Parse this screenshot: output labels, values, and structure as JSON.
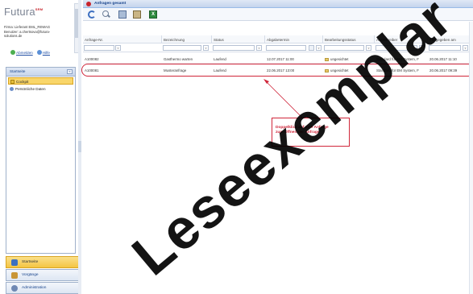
{
  "app": {
    "logo_text": "Futura",
    "logo_sup": "SRM",
    "user_lines": [
      "Firma: Lieferant EML_REWAG",
      "Benutzer: a.chertsova@futura-",
      "solutions.de"
    ],
    "logout_label": "Abmelden",
    "help_label": "Hilfe"
  },
  "sidebar": {
    "panel_title": "Startseite",
    "collapse_glyph": "«",
    "items": [
      {
        "label": "Cockpit",
        "selected": true
      },
      {
        "label": "Persönliche Daten",
        "selected": false
      }
    ]
  },
  "bottom_tabs": [
    {
      "label": "Startseite",
      "active": true
    },
    {
      "label": "Vorgänge",
      "active": false
    },
    {
      "label": "Administration",
      "active": false
    }
  ],
  "main": {
    "title": "Anfragen gesamt",
    "toolbar": {
      "excel_glyph": "X"
    },
    "columns": [
      {
        "label": "Anfrage-Nr."
      },
      {
        "label": "Bezeichnung"
      },
      {
        "label": "Status"
      },
      {
        "label": "Abgabetermin"
      },
      {
        "label": "Bearbeitungsstatus"
      },
      {
        "label": "Ausschreiber"
      },
      {
        "label": "Freigegeben am"
      }
    ],
    "filter_glyph": "▿",
    "rows": [
      [
        "A100082",
        "Gasthermo warten",
        "Laufend",
        "12.07.2017 11:00",
        "ungesichtet",
        "Standard für EM System, F",
        "20.06.2017 11:10"
      ],
      [
        "A100081",
        "Musteranfrage",
        "Laufend",
        "22.06.2017 13:00",
        "ungesichtet",
        "Standard für EM System, F",
        "20.06.2017 09:39"
      ]
    ],
    "callout_lines": [
      "Doppelklick auf eine Anfrage",
      "zum Öffnen der Anfrage"
    ]
  },
  "watermark": "Leseexemplar",
  "colors": {
    "accent": "#15428b",
    "highlight_red": "#d0263a",
    "selected_yellow": "#f9d66a"
  }
}
